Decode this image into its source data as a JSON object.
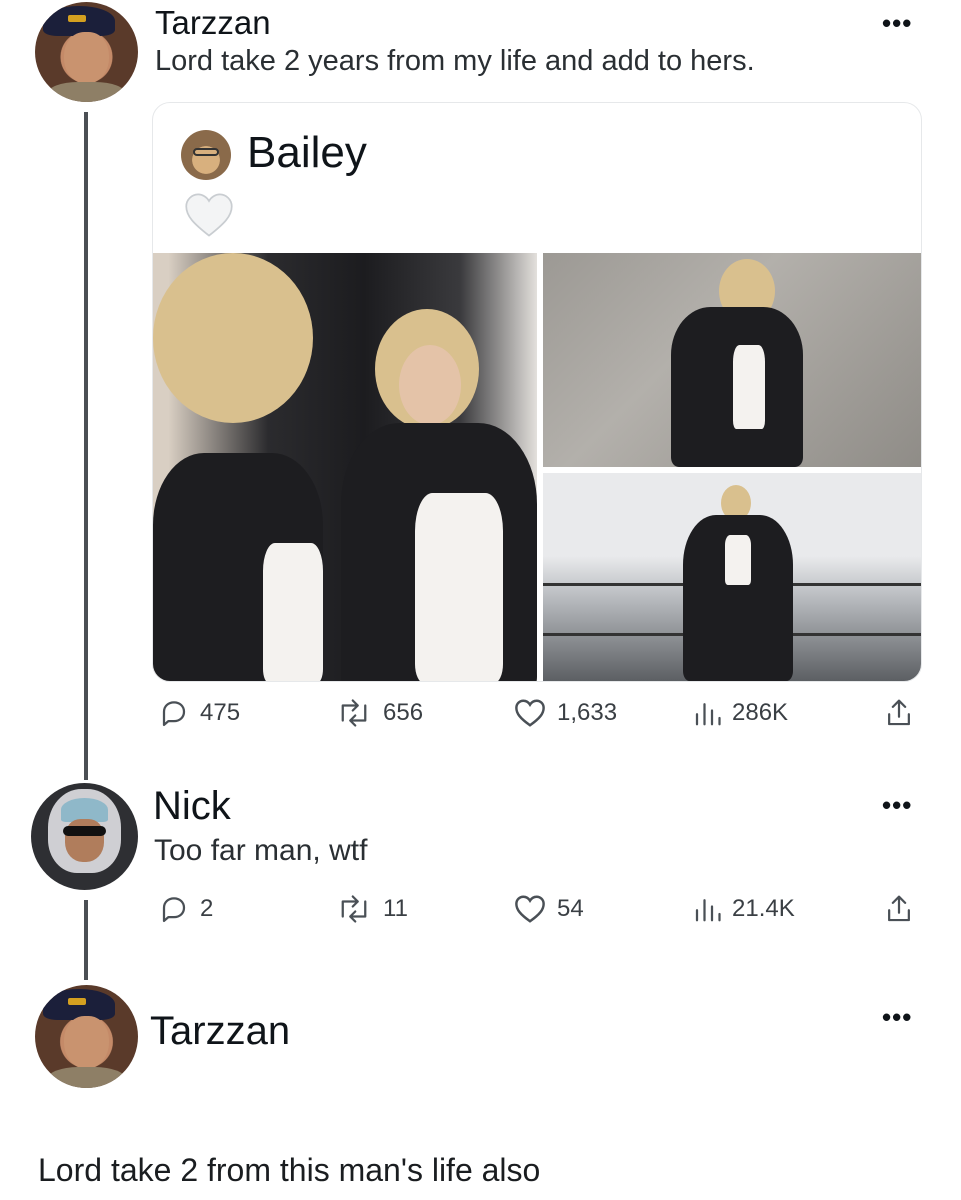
{
  "post": {
    "author": "Tarzzan",
    "text": "Lord take 2 years from my life and add to hers.",
    "quote": {
      "author": "Bailey",
      "photos": [
        "mirror-photo",
        "wall-photo",
        "rink-photo"
      ]
    },
    "stats": {
      "replies": "475",
      "reposts": "656",
      "likes": "1,633",
      "views": "286K"
    }
  },
  "reply1": {
    "author": "Nick",
    "text": "Too far man, wtf",
    "stats": {
      "replies": "2",
      "reposts": "11",
      "likes": "54",
      "views": "21.4K"
    }
  },
  "reply2": {
    "author": "Tarzzan",
    "text": "Lord take 2 from this man's life also"
  },
  "icons": {
    "more": "•••",
    "reply": "reply-icon",
    "repost": "repost-icon",
    "like": "heart-icon",
    "views": "views-icon",
    "share": "share-icon"
  }
}
